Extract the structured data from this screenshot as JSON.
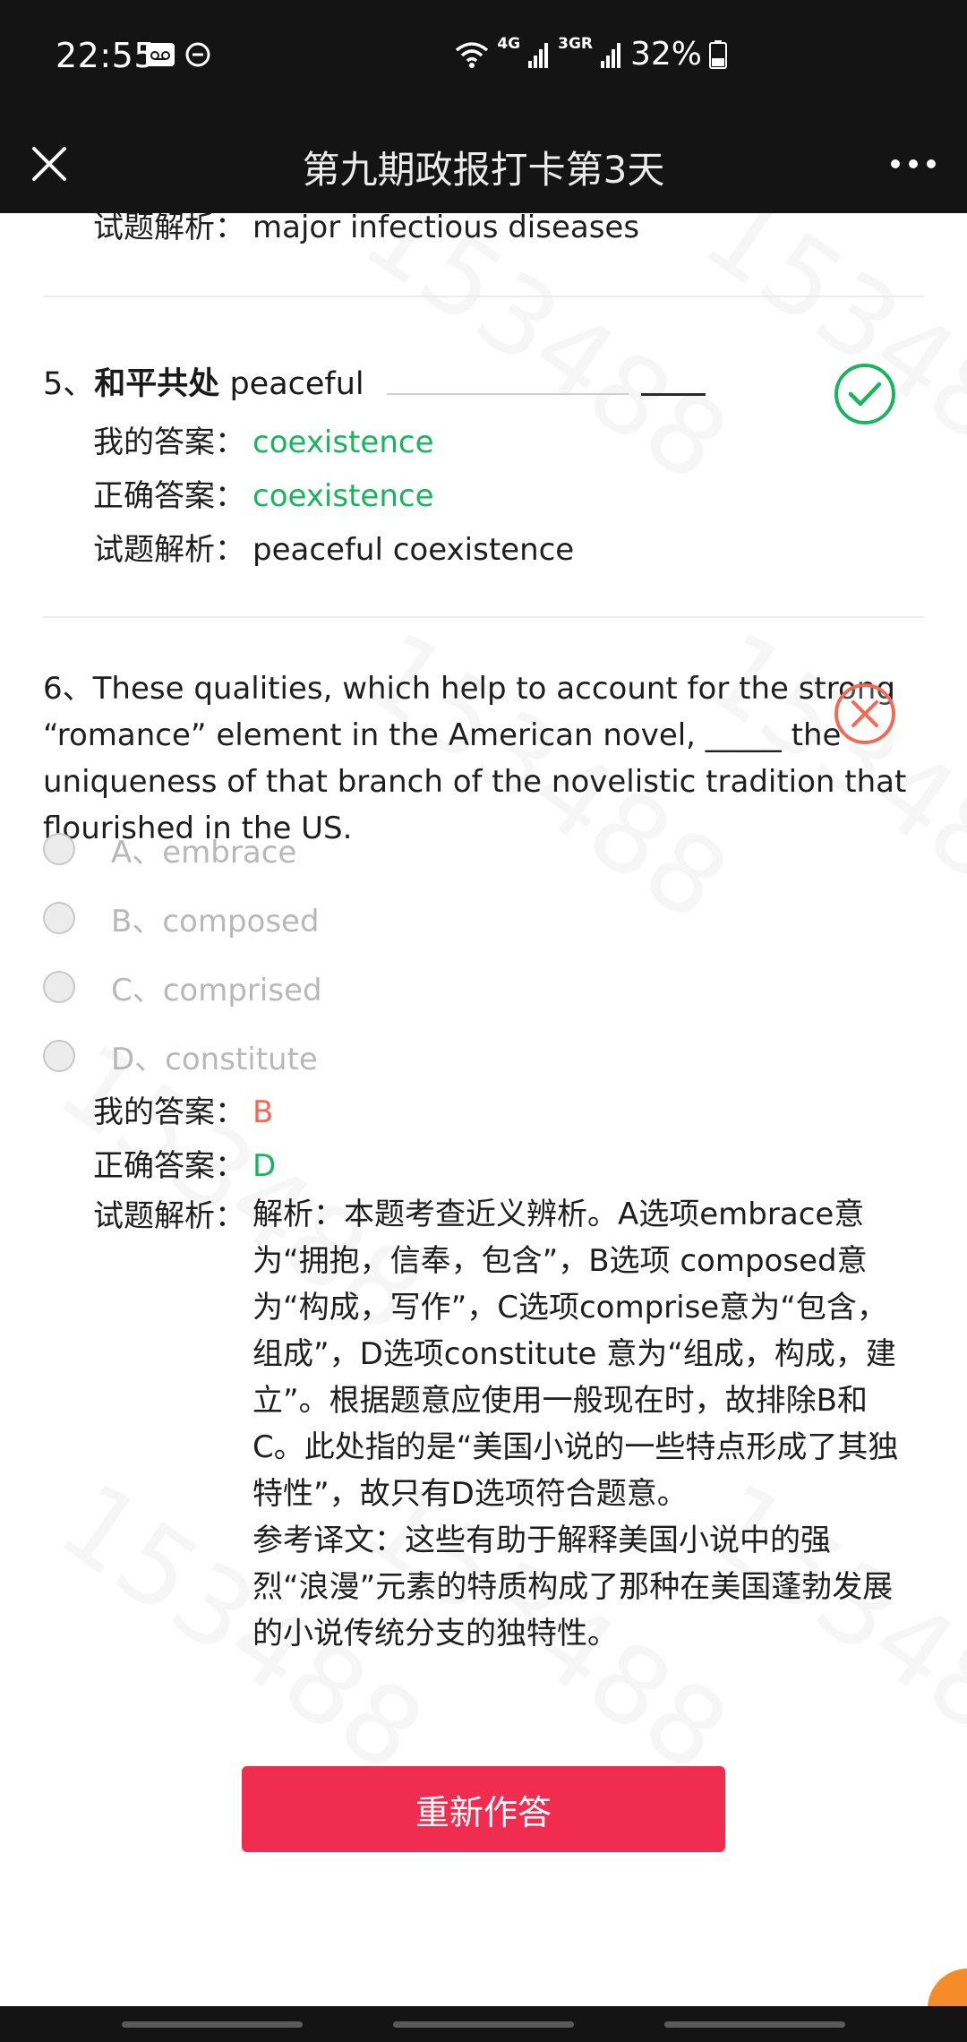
{
  "status_bar": {
    "time": "22:55",
    "signal_4g": "4G",
    "signal_3g": "3GR",
    "battery": "32%"
  },
  "nav": {
    "title": "第九期政报打卡第3天"
  },
  "prev_question": {
    "analysis_label": "试题解析：",
    "analysis_text": "major infectious diseases"
  },
  "q5": {
    "number": "5、",
    "bold": "和平共处",
    "prompt": "peaceful",
    "my_answer_label": "我的答案：",
    "my_answer": "coexistence",
    "correct_label": "正确答案：",
    "correct_answer": "coexistence",
    "analysis_label": "试题解析：",
    "analysis_text": "peaceful coexistence"
  },
  "q6": {
    "number": "6、",
    "text": "These qualities, which help to account for the strong “romance” element in the American novel, _____ the uniqueness of that branch of the novelistic tradition that flourished in the US.",
    "options": [
      "A、embrace",
      "B、composed",
      "C、comprised",
      "D、constitute"
    ],
    "my_answer_label": "我的答案：",
    "my_answer": "B",
    "correct_label": "正确答案：",
    "correct_answer": "D",
    "analysis_label": "试题解析：",
    "analysis_text": "解析：本题考查近义辨析。A选项embrace意为“拥抱，信奉，包含”，B选项 composed意为“构成，写作”，C选项comprise意为“包含，组成”，D选项constitute 意为“组成，构成，建立”。根据题意应使用一般现在时，故排除B和C。此处指的是“美国小说的一些特点形成了其独特性”，故只有D选项符合题意。",
    "translation_text": "参考译文：这些有助于解释美国小说中的强烈“浪漫”元素的特质构成了那种在美国蓬勃发展的小说传统分支的独特性。"
  },
  "redo_button": "重新作答",
  "watermark": "153488",
  "colors": {
    "correct": "#1ab45f",
    "wrong": "#f06a55",
    "button": "#f02d51",
    "bar": "#141414"
  }
}
